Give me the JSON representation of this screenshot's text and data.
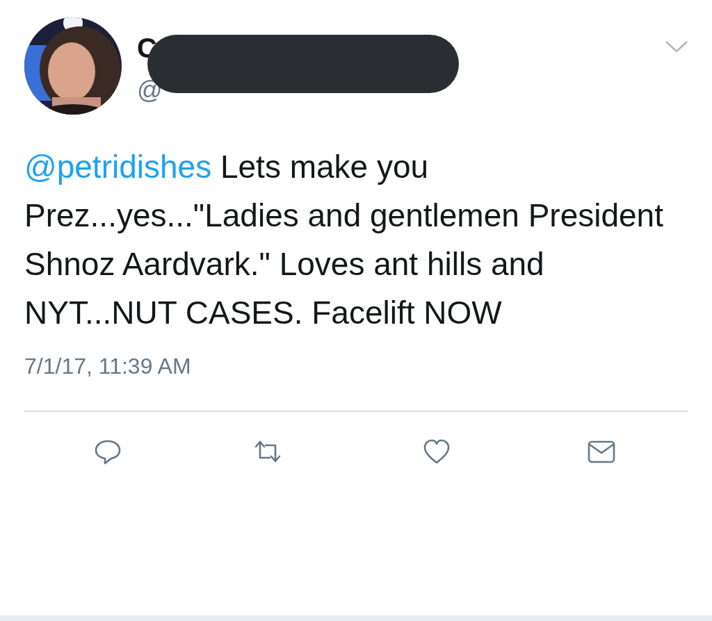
{
  "author": {
    "name": "C",
    "handle": "@",
    "redacted": true
  },
  "tweet": {
    "mention": "@petridishes",
    "body": "Lets make you Prez...yes...\"Ladies and gentlemen President Shnoz Aardvark.\" Loves ant hills and NYT...NUT CASES. Facelift NOW"
  },
  "timestamp": "7/1/17, 11:39 AM",
  "actions": [
    {
      "kind": "reply"
    },
    {
      "kind": "retweet"
    },
    {
      "kind": "like"
    },
    {
      "kind": "message"
    }
  ]
}
